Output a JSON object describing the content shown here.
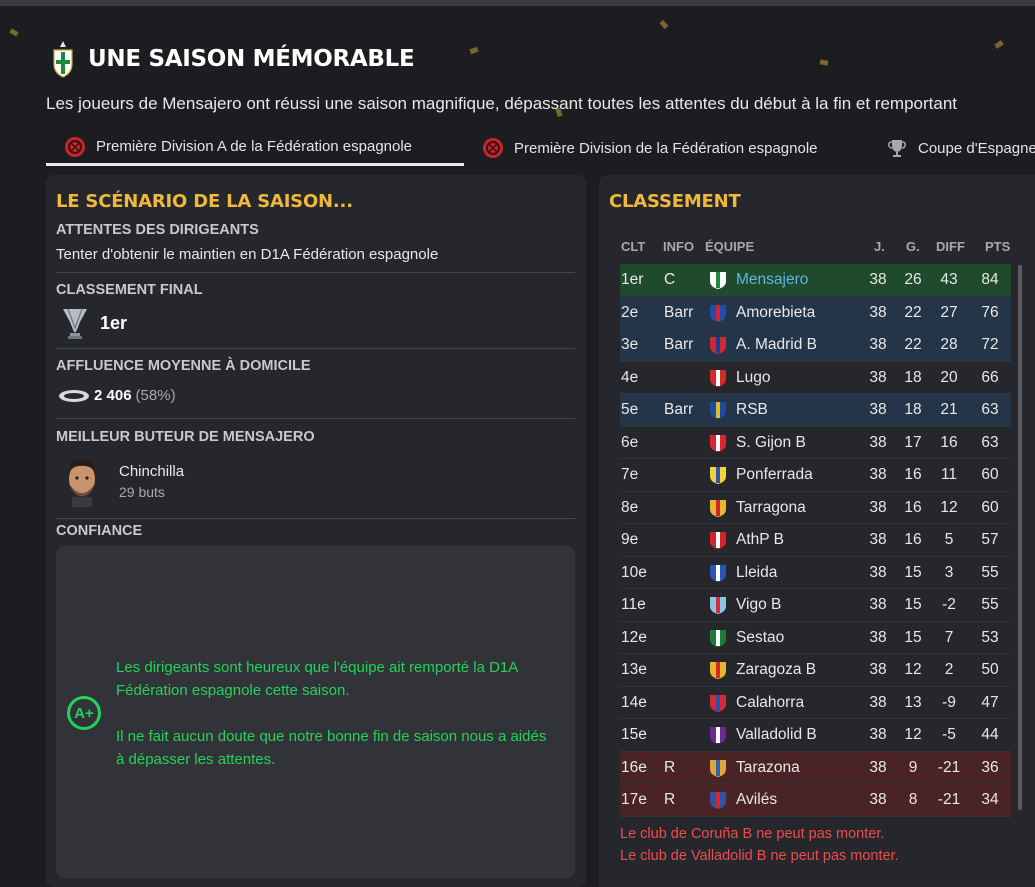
{
  "header": {
    "title": "UNE SAISON MÉMORABLE",
    "subtitle": "Les joueurs de Mensajero ont réussi une saison magnifique, dépassant toutes les attentes du début à la fin et remportant"
  },
  "tabs": [
    {
      "label": "Première Division A de la Fédération espagnole",
      "icon": "federation-badge-icon",
      "active": true
    },
    {
      "label": "Première Division de la Fédération espagnole",
      "icon": "federation-badge-icon",
      "active": false
    },
    {
      "label": "Coupe d'Espagne",
      "icon": "cup-icon",
      "active": false
    }
  ],
  "scenario": {
    "title": "LE SCÉNARIO DE LA SAISON...",
    "expectations_head": "ATTENTES DES DIRIGEANTS",
    "expectations_text": "Tenter d'obtenir le maintien en D1A Fédération espagnole",
    "final_head": "CLASSEMENT FINAL",
    "final_value": "1er",
    "attendance_head": "AFFLUENCE MOYENNE À DOMICILE",
    "attendance_value": "2 406",
    "attendance_pct": "(58%)",
    "scorer_head": "MEILLEUR BUTEUR DE MENSAJERO",
    "scorer_name": "Chinchilla",
    "scorer_goals": "29 buts",
    "confidence_head": "CONFIANCE",
    "confidence_grade": "A+",
    "confidence_p1": "Les dirigeants sont heureux que l'équipe ait remporté la D1A Fédération espagnole cette saison.",
    "confidence_p2": "Il ne fait aucun doute que notre bonne fin de saison nous a aidés à dépasser les attentes."
  },
  "standings": {
    "title": "CLASSEMENT",
    "headers": {
      "pos": "CLT",
      "info": "INFO",
      "team": "ÉQUIPE",
      "j": "J.",
      "g": "G.",
      "diff": "DIFF",
      "pts": "PTS"
    },
    "rows": [
      {
        "pos": "1er",
        "info": "C",
        "team": "Mensajero",
        "j": "38",
        "g": "26",
        "diff": "43",
        "pts": "84",
        "status": "champ",
        "c1": "#ffffff",
        "c2": "#1e8a3c"
      },
      {
        "pos": "2e",
        "info": "Barr",
        "team": "Amorebieta",
        "j": "38",
        "g": "22",
        "diff": "27",
        "pts": "76",
        "status": "promo",
        "c1": "#1f4fa8",
        "c2": "#d8232a"
      },
      {
        "pos": "3e",
        "info": "Barr",
        "team": "A. Madrid B",
        "j": "38",
        "g": "22",
        "diff": "28",
        "pts": "72",
        "status": "promo",
        "c1": "#cb2a2f",
        "c2": "#1d3c8f"
      },
      {
        "pos": "4e",
        "info": "",
        "team": "Lugo",
        "j": "38",
        "g": "18",
        "diff": "20",
        "pts": "66",
        "status": "",
        "c1": "#d32a2a",
        "c2": "#ffffff"
      },
      {
        "pos": "5e",
        "info": "Barr",
        "team": "RSB",
        "j": "38",
        "g": "18",
        "diff": "21",
        "pts": "63",
        "status": "promo",
        "c1": "#1b4d9c",
        "c2": "#e5b92c"
      },
      {
        "pos": "6e",
        "info": "",
        "team": "S. Gijon B",
        "j": "38",
        "g": "17",
        "diff": "16",
        "pts": "63",
        "status": "",
        "c1": "#d8262e",
        "c2": "#ffffff"
      },
      {
        "pos": "7e",
        "info": "",
        "team": "Ponferrada",
        "j": "38",
        "g": "16",
        "diff": "11",
        "pts": "60",
        "status": "",
        "c1": "#f0d23c",
        "c2": "#2a57a8"
      },
      {
        "pos": "8e",
        "info": "",
        "team": "Tarragona",
        "j": "38",
        "g": "16",
        "diff": "12",
        "pts": "60",
        "status": "",
        "c1": "#e8b730",
        "c2": "#c8262c"
      },
      {
        "pos": "9e",
        "info": "",
        "team": "AthP B",
        "j": "38",
        "g": "16",
        "diff": "5",
        "pts": "57",
        "status": "",
        "c1": "#d5232b",
        "c2": "#ffffff"
      },
      {
        "pos": "10e",
        "info": "",
        "team": "Lleida",
        "j": "38",
        "g": "15",
        "diff": "3",
        "pts": "55",
        "status": "",
        "c1": "#2a55b0",
        "c2": "#ffffff"
      },
      {
        "pos": "11e",
        "info": "",
        "team": "Vigo B",
        "j": "38",
        "g": "15",
        "diff": "-2",
        "pts": "55",
        "status": "",
        "c1": "#8cc4ea",
        "c2": "#d22f3a"
      },
      {
        "pos": "12e",
        "info": "",
        "team": "Sestao",
        "j": "38",
        "g": "15",
        "diff": "7",
        "pts": "53",
        "status": "",
        "c1": "#1f7a3a",
        "c2": "#ffffff"
      },
      {
        "pos": "13e",
        "info": "",
        "team": "Zaragoza B",
        "j": "38",
        "g": "12",
        "diff": "2",
        "pts": "50",
        "status": "",
        "c1": "#e5b52f",
        "c2": "#d12a2a"
      },
      {
        "pos": "14e",
        "info": "",
        "team": "Calahorra",
        "j": "38",
        "g": "13",
        "diff": "-9",
        "pts": "47",
        "status": "",
        "c1": "#d32a36",
        "c2": "#2c4fa8"
      },
      {
        "pos": "15e",
        "info": "",
        "team": "Valladolid B",
        "j": "38",
        "g": "12",
        "diff": "-5",
        "pts": "44",
        "status": "",
        "c1": "#6b2a8c",
        "c2": "#ffffff"
      },
      {
        "pos": "16e",
        "info": "R",
        "team": "Tarazona",
        "j": "38",
        "g": "9",
        "diff": "-21",
        "pts": "36",
        "status": "releg",
        "c1": "#e0a53a",
        "c2": "#2d63b0"
      },
      {
        "pos": "17e",
        "info": "R",
        "team": "Avilés",
        "j": "38",
        "g": "8",
        "diff": "-21",
        "pts": "34",
        "status": "releg",
        "c1": "#2b53a8",
        "c2": "#d8262e"
      }
    ],
    "notes": [
      "Le club de Coruña B ne peut pas monter.",
      "Le club de Valladolid B ne peut pas monter."
    ]
  },
  "colors": {
    "accent": "#f0b93a",
    "positive": "#22d35a",
    "warning": "#ef4c4c",
    "link": "#5fb4e8"
  }
}
